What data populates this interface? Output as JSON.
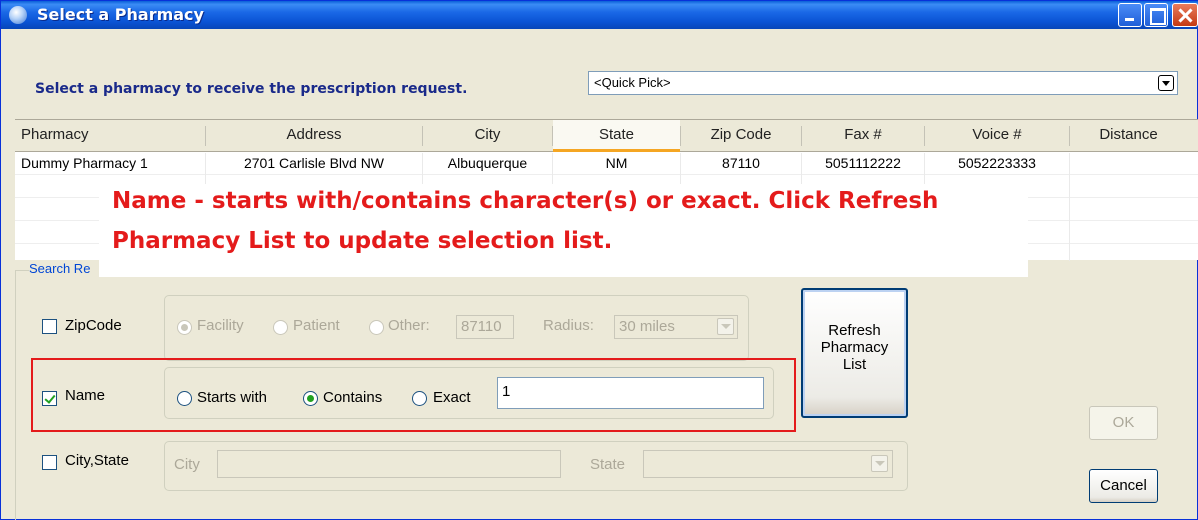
{
  "window": {
    "title": "Select a Pharmacy"
  },
  "instruction": "Select a pharmacy to receive the prescription request.",
  "quick_pick": {
    "value": "<Quick Pick>"
  },
  "table": {
    "columns": [
      "Pharmacy",
      "Address",
      "City",
      "State",
      "Zip Code",
      "Fax #",
      "Voice #",
      "Distance"
    ],
    "rows": [
      [
        "Dummy Pharmacy 1",
        "2701 Carlisle Blvd NW",
        "Albuquerque",
        "NM",
        "87110",
        "5051112222",
        "5052223333",
        ""
      ]
    ]
  },
  "search": {
    "group_label": "Search Re",
    "zipcode": {
      "label": "ZipCode",
      "checked": false,
      "options": [
        "Facility",
        "Patient",
        "Other:"
      ],
      "selected": "Facility",
      "other_value": "87110",
      "radius_label": "Radius:",
      "radius_value": "30 miles"
    },
    "name": {
      "label": "Name",
      "checked": true,
      "options": [
        "Starts with",
        "Contains",
        "Exact"
      ],
      "selected": "Contains",
      "value": "1"
    },
    "citystate": {
      "label": "City,State",
      "checked": false,
      "city_label": "City",
      "city_value": "",
      "state_label": "State",
      "state_value": ""
    }
  },
  "buttons": {
    "refresh_line1": "Refresh",
    "refresh_line2": "Pharmacy",
    "refresh_line3": "List",
    "ok": "OK",
    "cancel": "Cancel"
  },
  "annotation": {
    "line1": "Name - starts with/contains character(s) or exact.  Click Refresh",
    "line2": "Pharmacy List to update selection list.",
    "color": "#e41b1b"
  }
}
